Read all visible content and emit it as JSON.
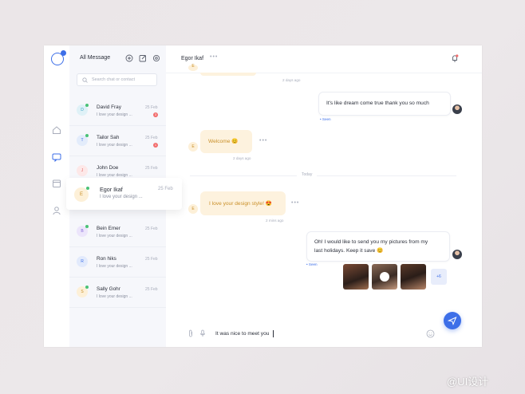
{
  "sidebar": {
    "title": "All Message",
    "search_placeholder": "Search chat or contact",
    "contacts": [
      {
        "initial": "D",
        "name": "David Fray",
        "preview": "I love your design ...",
        "date": "25 Feb",
        "badge": "3",
        "online": true,
        "color": "#dff1f7",
        "text_color": "#3aa3c6"
      },
      {
        "initial": "T",
        "name": "Tailor Sah",
        "preview": "I love your design ...",
        "date": "25 Feb",
        "badge": "1",
        "online": true,
        "color": "#e3ecfb",
        "text_color": "#3d6fe8"
      },
      {
        "initial": "J",
        "name": "John Doe",
        "preview": "I love your design ...",
        "date": "25 Feb",
        "badge": "",
        "online": false,
        "color": "#fde8e8",
        "text_color": "#e56a6a"
      },
      {
        "initial": "B",
        "name": "Bein Emer",
        "preview": "I love your design ...",
        "date": "25 Feb",
        "badge": "",
        "online": true,
        "color": "#ece5fb",
        "text_color": "#8467d9"
      },
      {
        "initial": "R",
        "name": "Ron hiks",
        "preview": "I love your design ...",
        "date": "25 Feb",
        "badge": "",
        "online": false,
        "color": "#e2eafc",
        "text_color": "#3d6fe8"
      },
      {
        "initial": "S",
        "name": "Sally Gohr",
        "preview": "I love your design ...",
        "date": "25 Feb",
        "badge": "",
        "online": true,
        "color": "#fdf0d8",
        "text_color": "#c98f28"
      }
    ],
    "selected": {
      "initial": "E",
      "name": "Egor Ikaf",
      "preview": "I love your design ...",
      "date": "25 Feb",
      "online": true
    }
  },
  "chat": {
    "contact_name": "Egor Ikaf",
    "messages": {
      "top_time": "2 days ago",
      "out1_text": "It's like dream come true thank you so much",
      "out1_seen": "• Seen",
      "in1_text": "Welcome 😊",
      "in1_time": "2 days ago",
      "divider": "Today",
      "in2_text": "I love your design style! 😍",
      "in2_time": "2 mins ago",
      "out2_line1": "Oh! I would like to send you my pictures from my",
      "out2_line2": "last holidays. Keep it save 😊",
      "out2_seen": "• Seen",
      "more_media": "+6"
    },
    "input_value": "It was nice to meet you"
  },
  "accent": "#3d6fe8",
  "watermark": "@UI设计"
}
